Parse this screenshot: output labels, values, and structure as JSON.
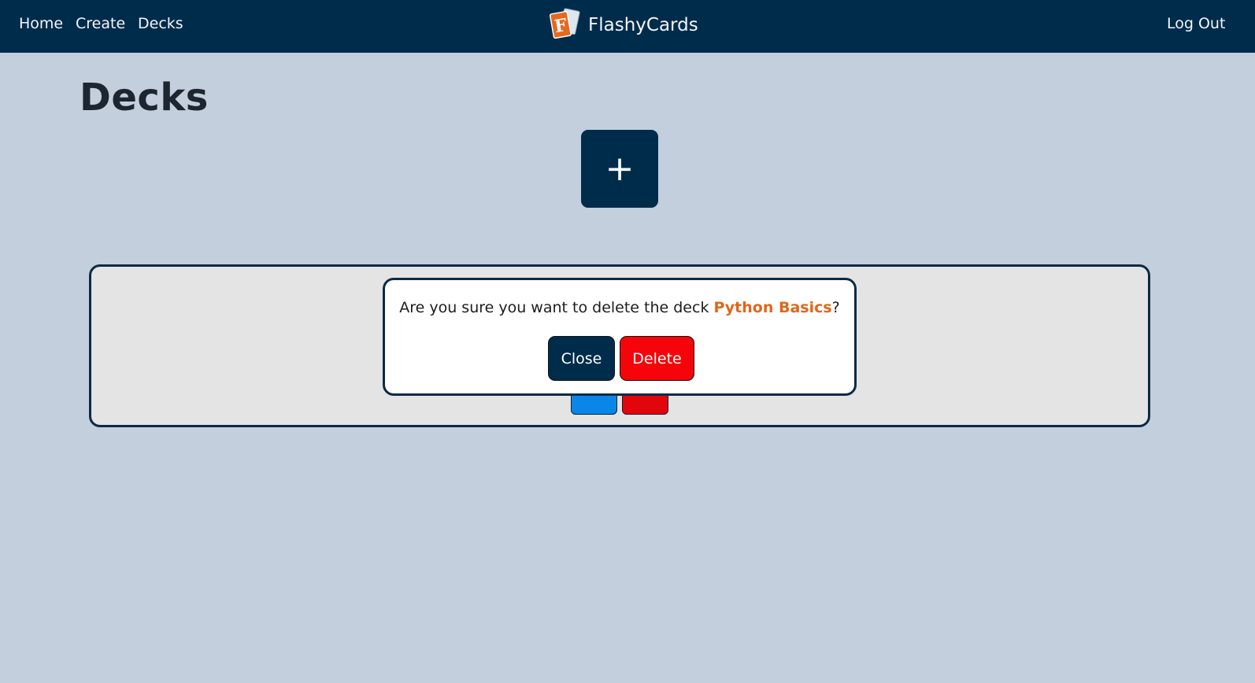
{
  "nav": {
    "links": [
      {
        "label": "Home"
      },
      {
        "label": "Create"
      },
      {
        "label": "Decks"
      }
    ],
    "brand": {
      "text": "FlashyCards",
      "logo_icon": "flashcards-logo-icon"
    },
    "logout_label": "Log Out"
  },
  "page": {
    "title": "Decks",
    "add_button_label": "+"
  },
  "modal": {
    "message_prefix": "Are you sure you want to delete the deck ",
    "deck_name": "Python Basics",
    "message_suffix": "?",
    "close_label": "Close",
    "delete_label": "Delete"
  },
  "colors": {
    "navbar": "#002c4c",
    "background": "#c3cfdc",
    "accent_orange": "#e0661b",
    "danger_red": "#f5050a",
    "edit_blue": "#0a86e8"
  }
}
